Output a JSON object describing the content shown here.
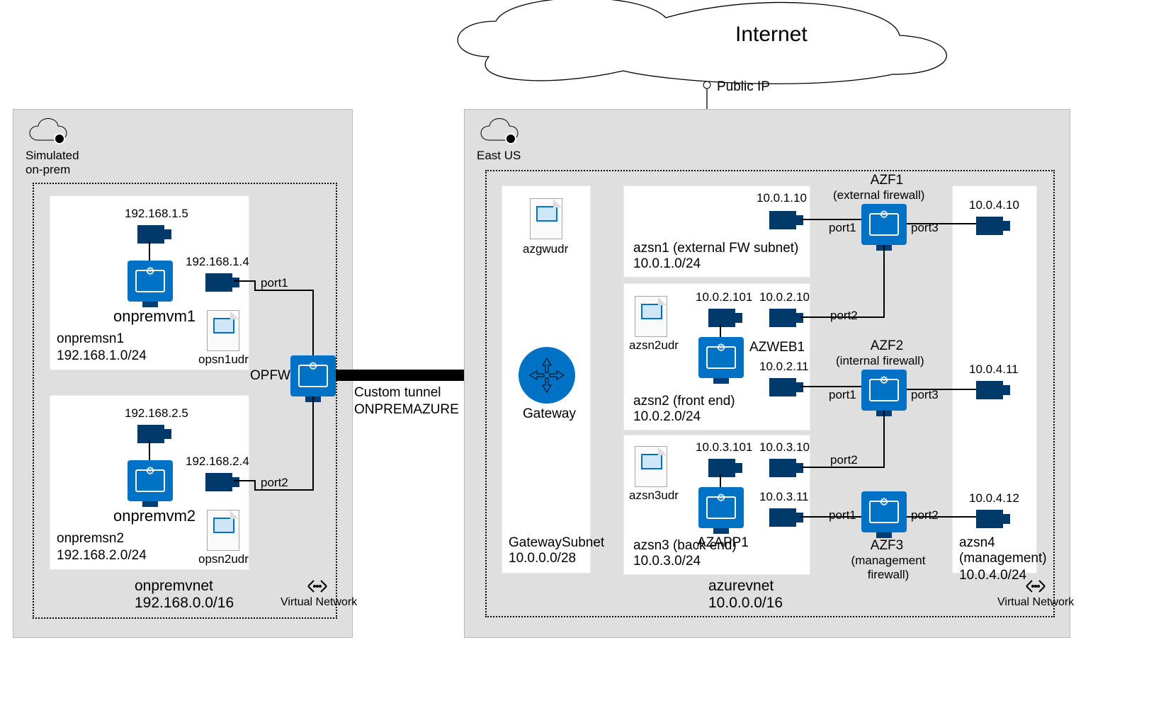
{
  "internet": {
    "label": "Internet",
    "public_ip": "Public IP"
  },
  "onprem": {
    "region": "Simulated\non-prem",
    "vnet": {
      "name": "onpremvnet",
      "cidr": "192.168.0.0/16",
      "label": "Virtual Network"
    },
    "fw": {
      "name": "OPFW",
      "port1": "port1",
      "port2": "port2"
    },
    "tunnel": {
      "line1": "Custom tunnel",
      "line2": "ONPREMAZURE"
    },
    "sn1": {
      "name": "onpremsn1",
      "cidr": "192.168.1.0/24",
      "vm": "onpremvm1",
      "nic1": "192.168.1.5",
      "nic2": "192.168.1.4",
      "udr": "opsn1udr"
    },
    "sn2": {
      "name": "onpremsn2",
      "cidr": "192.168.2.0/24",
      "vm": "onpremvm2",
      "nic1": "192.168.2.5",
      "nic2": "192.168.2.4",
      "udr": "opsn2udr"
    }
  },
  "azure": {
    "region": "East US",
    "vnet": {
      "name": "azurevnet",
      "cidr": "10.0.0.0/16",
      "label": "Virtual Network"
    },
    "gateway": {
      "name": "Gateway",
      "subnet_name": "GatewaySubnet",
      "subnet_cidr": "10.0.0.0/28",
      "udr": "azgwudr"
    },
    "sn1": {
      "name": "azsn1 (external FW subnet)",
      "cidr": "10.0.1.0/24",
      "nic": "10.0.1.10"
    },
    "sn2": {
      "name": "azsn2 (front end)",
      "cidr": "10.0.2.0/24",
      "udr": "azsn2udr",
      "vm": "AZWEB1",
      "vm_nic": "10.0.2.101",
      "fw_p1": "10.0.2.10",
      "fw_p1_b": "10.0.2.11"
    },
    "sn3": {
      "name": "azsn3 (back end)",
      "cidr": "10.0.3.0/24",
      "udr": "azsn3udr",
      "vm": "AZAPP1",
      "vm_nic": "10.0.3.101",
      "fw_p1": "10.0.3.10",
      "fw_p1_b": "10.0.3.11"
    },
    "sn4": {
      "name": "azsn4\n(management)",
      "cidr": "10.0.4.0/24",
      "nic1": "10.0.4.10",
      "nic2": "10.0.4.11",
      "nic3": "10.0.4.12"
    },
    "azf1": {
      "name": "AZF1",
      "sub": "(external firewall)",
      "port1": "port1",
      "port3": "port3",
      "port2": "port2"
    },
    "azf2": {
      "name": "AZF2",
      "sub": "(internal firewall)",
      "port1": "port1",
      "port3": "port3",
      "port2": "port2"
    },
    "azf3": {
      "name": "AZF3",
      "sub": "(management\nfirewall)",
      "port1": "port1",
      "port2": "port2"
    }
  }
}
